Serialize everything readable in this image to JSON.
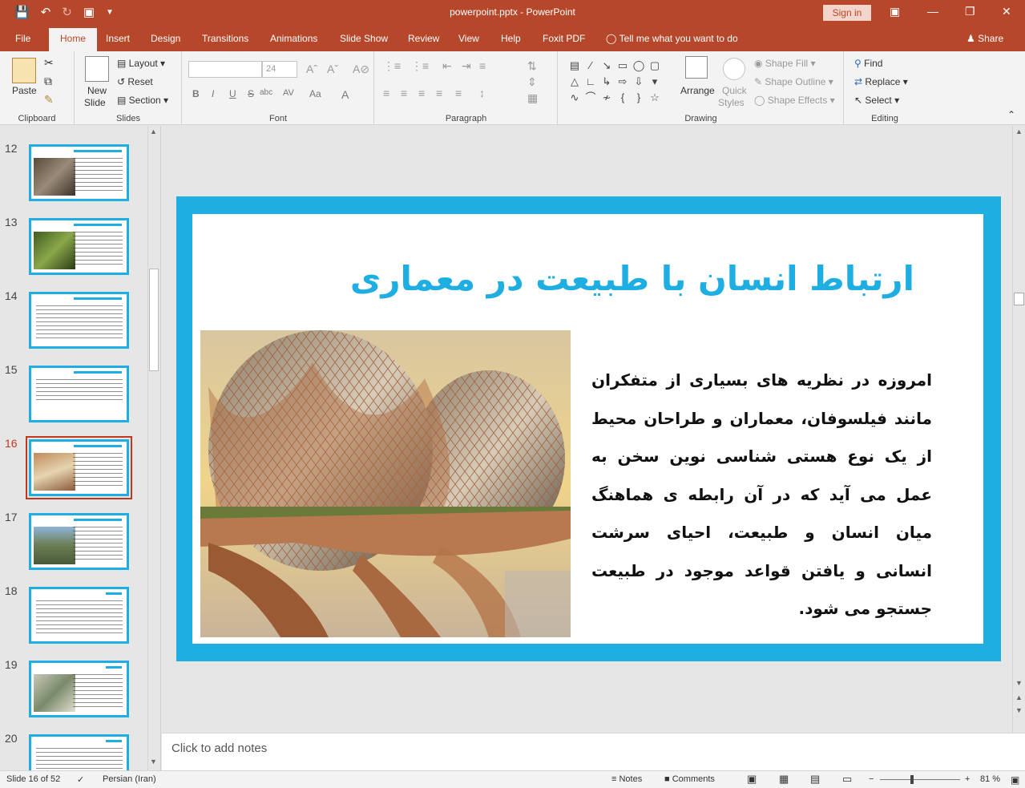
{
  "window": {
    "title": "powerpoint.pptx  -  PowerPoint",
    "sign_in": "Sign in"
  },
  "tabs": [
    "File",
    "Home",
    "Insert",
    "Design",
    "Transitions",
    "Animations",
    "Slide Show",
    "Review",
    "View",
    "Help",
    "Foxit PDF"
  ],
  "tell_me": "Tell me what you want to do",
  "share": "Share",
  "ribbon": {
    "clipboard": {
      "label": "Clipboard",
      "paste": "Paste"
    },
    "slides": {
      "label": "Slides",
      "new_slide_1": "New",
      "new_slide_2": "Slide",
      "layout": "Layout",
      "reset": "Reset",
      "section": "Section"
    },
    "font": {
      "label": "Font",
      "size": "24",
      "bold": "B",
      "italic": "I",
      "underline": "U",
      "strike": "S",
      "shadow": "abc",
      "spacing": "AV",
      "case": "Aa",
      "color": "A"
    },
    "paragraph": {
      "label": "Paragraph"
    },
    "drawing": {
      "label": "Drawing",
      "arrange": "Arrange",
      "quick_styles_1": "Quick",
      "quick_styles_2": "Styles",
      "shape_fill": "Shape Fill",
      "shape_outline": "Shape Outline",
      "shape_effects": "Shape Effects"
    },
    "editing": {
      "label": "Editing",
      "find": "Find",
      "replace": "Replace",
      "select": "Select"
    }
  },
  "thumbnails": [
    {
      "number": "12"
    },
    {
      "number": "13"
    },
    {
      "number": "14"
    },
    {
      "number": "15"
    },
    {
      "number": "16"
    },
    {
      "number": "17"
    },
    {
      "number": "18"
    },
    {
      "number": "19"
    },
    {
      "number": "20"
    }
  ],
  "slide": {
    "title": "ارتباط انسان با طبیعت در معماری",
    "body": "امروزه در نظریه های بسیاری از متفکران مانند فیلسوفان، معماران و طراحان محیط از یک نوع هستی شناسی نوین سخن به عمل می آید که در آن رابطه ی هماهنگ میان انسان و طبیعت، احیای سرشت انسانی و یافتن قواعد موجود در طبیعت جستجو می شود."
  },
  "notes_placeholder": "Click to add notes",
  "status": {
    "slide_info": "Slide 16 of 52",
    "language": "Persian (Iran)",
    "notes": "Notes",
    "comments": "Comments",
    "zoom": "81 %"
  },
  "colors": {
    "accent": "#b7472a",
    "slide_blue": "#1eaee2"
  }
}
